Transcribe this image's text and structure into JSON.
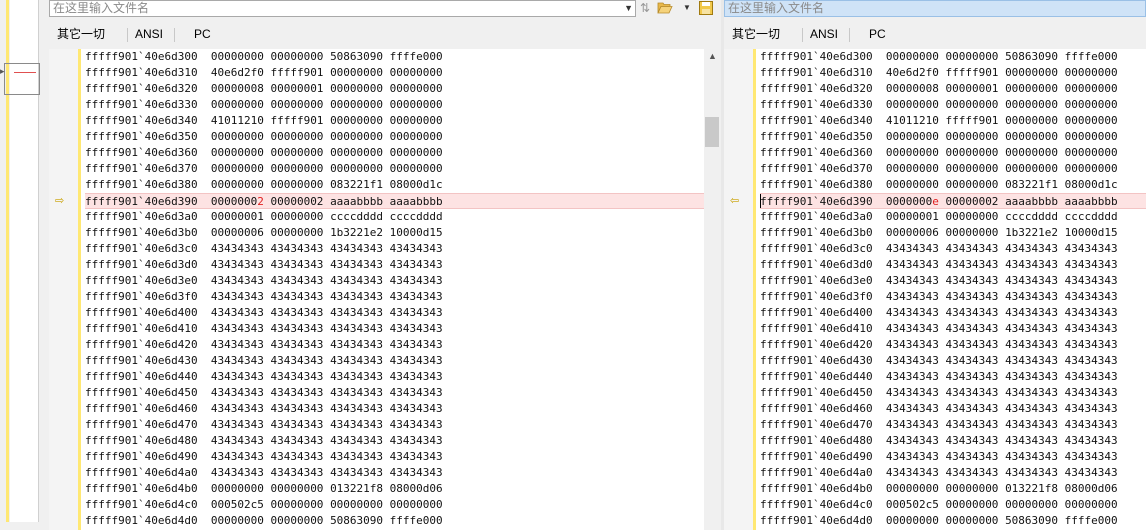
{
  "left": {
    "filename_placeholder": "在这里输入文件名",
    "toolbar": {
      "filter": "其它一切",
      "encoding": "ANSI",
      "platform": "PC"
    }
  },
  "right": {
    "filename_placeholder": "在这里输入文件名",
    "toolbar": {
      "filter": "其它一切",
      "encoding": "ANSI",
      "platform": "PC"
    }
  },
  "icons": {
    "dropdown": "chevron-down-icon",
    "swap": "swap-files-icon",
    "open": "folder-open-icon",
    "save": "save-icon",
    "diff_marker": "diff-arrow-icon"
  },
  "colors": {
    "diff_row_bg": "#fde3e3",
    "diff_text": "#e02020",
    "gutter_marker": "#ffe873",
    "selected_bar": "#cfe3f7"
  },
  "left_rows": [
    {
      "addr": "fffff901`40e6d300",
      "w1": "00000000",
      "w2": "00000000",
      "w3": "50863090",
      "w4": "ffffe000"
    },
    {
      "addr": "fffff901`40e6d310",
      "w1": "40e6d2f0",
      "w2": "fffff901",
      "w3": "00000000",
      "w4": "00000000"
    },
    {
      "addr": "fffff901`40e6d320",
      "w1": "00000008",
      "w2": "00000001",
      "w3": "00000000",
      "w4": "00000000"
    },
    {
      "addr": "fffff901`40e6d330",
      "w1": "00000000",
      "w2": "00000000",
      "w3": "00000000",
      "w4": "00000000"
    },
    {
      "addr": "fffff901`40e6d340",
      "w1": "41011210",
      "w2": "fffff901",
      "w3": "00000000",
      "w4": "00000000"
    },
    {
      "addr": "fffff901`40e6d350",
      "w1": "00000000",
      "w2": "00000000",
      "w3": "00000000",
      "w4": "00000000"
    },
    {
      "addr": "fffff901`40e6d360",
      "w1": "00000000",
      "w2": "00000000",
      "w3": "00000000",
      "w4": "00000000"
    },
    {
      "addr": "fffff901`40e6d370",
      "w1": "00000000",
      "w2": "00000000",
      "w3": "00000000",
      "w4": "00000000"
    },
    {
      "addr": "fffff901`40e6d380",
      "w1": "00000000",
      "w2": "00000000",
      "w3": "083221f1",
      "w4": "08000d1c"
    },
    {
      "addr": "fffff901`40e6d390",
      "w1a": "0000000",
      "w1b": "2",
      "w2": "00000002",
      "w3": "aaaabbbb",
      "w4": "aaaabbbb",
      "diff": true
    },
    {
      "addr": "fffff901`40e6d3a0",
      "w1": "00000001",
      "w2": "00000000",
      "w3": "ccccdddd",
      "w4": "ccccdddd"
    },
    {
      "addr": "fffff901`40e6d3b0",
      "w1": "00000006",
      "w2": "00000000",
      "w3": "1b3221e2",
      "w4": "10000d15"
    },
    {
      "addr": "fffff901`40e6d3c0",
      "w1": "43434343",
      "w2": "43434343",
      "w3": "43434343",
      "w4": "43434343"
    },
    {
      "addr": "fffff901`40e6d3d0",
      "w1": "43434343",
      "w2": "43434343",
      "w3": "43434343",
      "w4": "43434343"
    },
    {
      "addr": "fffff901`40e6d3e0",
      "w1": "43434343",
      "w2": "43434343",
      "w3": "43434343",
      "w4": "43434343"
    },
    {
      "addr": "fffff901`40e6d3f0",
      "w1": "43434343",
      "w2": "43434343",
      "w3": "43434343",
      "w4": "43434343"
    },
    {
      "addr": "fffff901`40e6d400",
      "w1": "43434343",
      "w2": "43434343",
      "w3": "43434343",
      "w4": "43434343"
    },
    {
      "addr": "fffff901`40e6d410",
      "w1": "43434343",
      "w2": "43434343",
      "w3": "43434343",
      "w4": "43434343"
    },
    {
      "addr": "fffff901`40e6d420",
      "w1": "43434343",
      "w2": "43434343",
      "w3": "43434343",
      "w4": "43434343"
    },
    {
      "addr": "fffff901`40e6d430",
      "w1": "43434343",
      "w2": "43434343",
      "w3": "43434343",
      "w4": "43434343"
    },
    {
      "addr": "fffff901`40e6d440",
      "w1": "43434343",
      "w2": "43434343",
      "w3": "43434343",
      "w4": "43434343"
    },
    {
      "addr": "fffff901`40e6d450",
      "w1": "43434343",
      "w2": "43434343",
      "w3": "43434343",
      "w4": "43434343"
    },
    {
      "addr": "fffff901`40e6d460",
      "w1": "43434343",
      "w2": "43434343",
      "w3": "43434343",
      "w4": "43434343"
    },
    {
      "addr": "fffff901`40e6d470",
      "w1": "43434343",
      "w2": "43434343",
      "w3": "43434343",
      "w4": "43434343"
    },
    {
      "addr": "fffff901`40e6d480",
      "w1": "43434343",
      "w2": "43434343",
      "w3": "43434343",
      "w4": "43434343"
    },
    {
      "addr": "fffff901`40e6d490",
      "w1": "43434343",
      "w2": "43434343",
      "w3": "43434343",
      "w4": "43434343"
    },
    {
      "addr": "fffff901`40e6d4a0",
      "w1": "43434343",
      "w2": "43434343",
      "w3": "43434343",
      "w4": "43434343"
    },
    {
      "addr": "fffff901`40e6d4b0",
      "w1": "00000000",
      "w2": "00000000",
      "w3": "013221f8",
      "w4": "08000d06"
    },
    {
      "addr": "fffff901`40e6d4c0",
      "w1": "000502c5",
      "w2": "00000000",
      "w3": "00000000",
      "w4": "00000000"
    },
    {
      "addr": "fffff901`40e6d4d0",
      "w1": "00000000",
      "w2": "00000000",
      "w3": "50863090",
      "w4": "ffffe000"
    }
  ],
  "right_rows": [
    {
      "addr": "fffff901`40e6d300",
      "w1": "00000000",
      "w2": "00000000",
      "w3": "50863090",
      "w4": "ffffe000"
    },
    {
      "addr": "fffff901`40e6d310",
      "w1": "40e6d2f0",
      "w2": "fffff901",
      "w3": "00000000",
      "w4": "00000000"
    },
    {
      "addr": "fffff901`40e6d320",
      "w1": "00000008",
      "w2": "00000001",
      "w3": "00000000",
      "w4": "00000000"
    },
    {
      "addr": "fffff901`40e6d330",
      "w1": "00000000",
      "w2": "00000000",
      "w3": "00000000",
      "w4": "00000000"
    },
    {
      "addr": "fffff901`40e6d340",
      "w1": "41011210",
      "w2": "fffff901",
      "w3": "00000000",
      "w4": "00000000"
    },
    {
      "addr": "fffff901`40e6d350",
      "w1": "00000000",
      "w2": "00000000",
      "w3": "00000000",
      "w4": "00000000"
    },
    {
      "addr": "fffff901`40e6d360",
      "w1": "00000000",
      "w2": "00000000",
      "w3": "00000000",
      "w4": "00000000"
    },
    {
      "addr": "fffff901`40e6d370",
      "w1": "00000000",
      "w2": "00000000",
      "w3": "00000000",
      "w4": "00000000"
    },
    {
      "addr": "fffff901`40e6d380",
      "w1": "00000000",
      "w2": "00000000",
      "w3": "083221f1",
      "w4": "08000d1c"
    },
    {
      "addr": "fffff901`40e6d390",
      "w1a": "0000000",
      "w1b": "e",
      "w2": "00000002",
      "w3": "aaaabbbb",
      "w4": "aaaabbbb",
      "diff": true
    },
    {
      "addr": "fffff901`40e6d3a0",
      "w1": "00000001",
      "w2": "00000000",
      "w3": "ccccdddd",
      "w4": "ccccdddd"
    },
    {
      "addr": "fffff901`40e6d3b0",
      "w1": "00000006",
      "w2": "00000000",
      "w3": "1b3221e2",
      "w4": "10000d15"
    },
    {
      "addr": "fffff901`40e6d3c0",
      "w1": "43434343",
      "w2": "43434343",
      "w3": "43434343",
      "w4": "43434343"
    },
    {
      "addr": "fffff901`40e6d3d0",
      "w1": "43434343",
      "w2": "43434343",
      "w3": "43434343",
      "w4": "43434343"
    },
    {
      "addr": "fffff901`40e6d3e0",
      "w1": "43434343",
      "w2": "43434343",
      "w3": "43434343",
      "w4": "43434343"
    },
    {
      "addr": "fffff901`40e6d3f0",
      "w1": "43434343",
      "w2": "43434343",
      "w3": "43434343",
      "w4": "43434343"
    },
    {
      "addr": "fffff901`40e6d400",
      "w1": "43434343",
      "w2": "43434343",
      "w3": "43434343",
      "w4": "43434343"
    },
    {
      "addr": "fffff901`40e6d410",
      "w1": "43434343",
      "w2": "43434343",
      "w3": "43434343",
      "w4": "43434343"
    },
    {
      "addr": "fffff901`40e6d420",
      "w1": "43434343",
      "w2": "43434343",
      "w3": "43434343",
      "w4": "43434343"
    },
    {
      "addr": "fffff901`40e6d430",
      "w1": "43434343",
      "w2": "43434343",
      "w3": "43434343",
      "w4": "43434343"
    },
    {
      "addr": "fffff901`40e6d440",
      "w1": "43434343",
      "w2": "43434343",
      "w3": "43434343",
      "w4": "43434343"
    },
    {
      "addr": "fffff901`40e6d450",
      "w1": "43434343",
      "w2": "43434343",
      "w3": "43434343",
      "w4": "43434343"
    },
    {
      "addr": "fffff901`40e6d460",
      "w1": "43434343",
      "w2": "43434343",
      "w3": "43434343",
      "w4": "43434343"
    },
    {
      "addr": "fffff901`40e6d470",
      "w1": "43434343",
      "w2": "43434343",
      "w3": "43434343",
      "w4": "43434343"
    },
    {
      "addr": "fffff901`40e6d480",
      "w1": "43434343",
      "w2": "43434343",
      "w3": "43434343",
      "w4": "43434343"
    },
    {
      "addr": "fffff901`40e6d490",
      "w1": "43434343",
      "w2": "43434343",
      "w3": "43434343",
      "w4": "43434343"
    },
    {
      "addr": "fffff901`40e6d4a0",
      "w1": "43434343",
      "w2": "43434343",
      "w3": "43434343",
      "w4": "43434343"
    },
    {
      "addr": "fffff901`40e6d4b0",
      "w1": "00000000",
      "w2": "00000000",
      "w3": "013221f8",
      "w4": "08000d06"
    },
    {
      "addr": "fffff901`40e6d4c0",
      "w1": "000502c5",
      "w2": "00000000",
      "w3": "00000000",
      "w4": "00000000"
    },
    {
      "addr": "fffff901`40e6d4d0",
      "w1": "00000000",
      "w2": "00000000",
      "w3": "50863090",
      "w4": "ffffe000"
    }
  ]
}
